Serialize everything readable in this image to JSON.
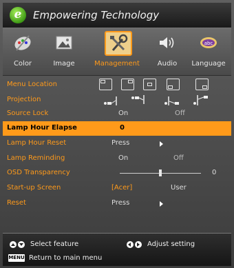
{
  "title": "Empowering Technology",
  "logo_letter": "e",
  "tabs": [
    {
      "label": "Color",
      "icon": "color-palette-icon"
    },
    {
      "label": "Image",
      "icon": "image-icon"
    },
    {
      "label": "Management",
      "icon": "management-tools-icon",
      "active": true
    },
    {
      "label": "Audio",
      "icon": "speaker-icon"
    },
    {
      "label": "Language",
      "icon": "language-abc-icon"
    }
  ],
  "rows": {
    "menu_location": {
      "label": "Menu Location",
      "icons": [
        "top-left",
        "top-right",
        "center",
        "bottom-left",
        "bottom-right"
      ]
    },
    "projection": {
      "label": "Projection",
      "icons": [
        "front-desktop",
        "front-ceiling",
        "rear-desktop",
        "rear-ceiling"
      ]
    },
    "source_lock": {
      "label": "Source Lock",
      "on": "On",
      "off": "Off"
    },
    "lamp_hour_elapse": {
      "label": "Lamp Hour Elapse",
      "value": "0"
    },
    "lamp_hour_reset": {
      "label": "Lamp Hour Reset",
      "action": "Press"
    },
    "lamp_reminding": {
      "label": "Lamp Reminding",
      "on": "On",
      "off": "Off"
    },
    "osd_transparency": {
      "label": "OSD Transparency",
      "value": "0",
      "level": 0.5
    },
    "startup_screen": {
      "label": "Start-up Screen",
      "option1": "[Acer]",
      "option2": "User"
    },
    "reset": {
      "label": "Reset",
      "action": "Press"
    }
  },
  "footer": {
    "select_feature": "Select feature",
    "adjust_setting": "Adjust setting",
    "menu_key": "MENU",
    "return_text": "Return to main menu"
  },
  "colors": {
    "accent": "#ff9a1a",
    "background": "#4a4a4a"
  }
}
